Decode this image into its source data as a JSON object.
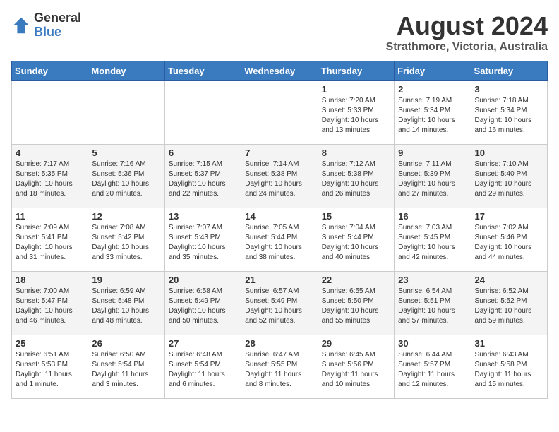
{
  "logo": {
    "line1": "General",
    "line2": "Blue"
  },
  "title": "August 2024",
  "subtitle": "Strathmore, Victoria, Australia",
  "days_header": [
    "Sunday",
    "Monday",
    "Tuesday",
    "Wednesday",
    "Thursday",
    "Friday",
    "Saturday"
  ],
  "weeks": [
    [
      {
        "num": "",
        "info": ""
      },
      {
        "num": "",
        "info": ""
      },
      {
        "num": "",
        "info": ""
      },
      {
        "num": "",
        "info": ""
      },
      {
        "num": "1",
        "info": "Sunrise: 7:20 AM\nSunset: 5:33 PM\nDaylight: 10 hours\nand 13 minutes."
      },
      {
        "num": "2",
        "info": "Sunrise: 7:19 AM\nSunset: 5:34 PM\nDaylight: 10 hours\nand 14 minutes."
      },
      {
        "num": "3",
        "info": "Sunrise: 7:18 AM\nSunset: 5:34 PM\nDaylight: 10 hours\nand 16 minutes."
      }
    ],
    [
      {
        "num": "4",
        "info": "Sunrise: 7:17 AM\nSunset: 5:35 PM\nDaylight: 10 hours\nand 18 minutes."
      },
      {
        "num": "5",
        "info": "Sunrise: 7:16 AM\nSunset: 5:36 PM\nDaylight: 10 hours\nand 20 minutes."
      },
      {
        "num": "6",
        "info": "Sunrise: 7:15 AM\nSunset: 5:37 PM\nDaylight: 10 hours\nand 22 minutes."
      },
      {
        "num": "7",
        "info": "Sunrise: 7:14 AM\nSunset: 5:38 PM\nDaylight: 10 hours\nand 24 minutes."
      },
      {
        "num": "8",
        "info": "Sunrise: 7:12 AM\nSunset: 5:38 PM\nDaylight: 10 hours\nand 26 minutes."
      },
      {
        "num": "9",
        "info": "Sunrise: 7:11 AM\nSunset: 5:39 PM\nDaylight: 10 hours\nand 27 minutes."
      },
      {
        "num": "10",
        "info": "Sunrise: 7:10 AM\nSunset: 5:40 PM\nDaylight: 10 hours\nand 29 minutes."
      }
    ],
    [
      {
        "num": "11",
        "info": "Sunrise: 7:09 AM\nSunset: 5:41 PM\nDaylight: 10 hours\nand 31 minutes."
      },
      {
        "num": "12",
        "info": "Sunrise: 7:08 AM\nSunset: 5:42 PM\nDaylight: 10 hours\nand 33 minutes."
      },
      {
        "num": "13",
        "info": "Sunrise: 7:07 AM\nSunset: 5:43 PM\nDaylight: 10 hours\nand 35 minutes."
      },
      {
        "num": "14",
        "info": "Sunrise: 7:05 AM\nSunset: 5:44 PM\nDaylight: 10 hours\nand 38 minutes."
      },
      {
        "num": "15",
        "info": "Sunrise: 7:04 AM\nSunset: 5:44 PM\nDaylight: 10 hours\nand 40 minutes."
      },
      {
        "num": "16",
        "info": "Sunrise: 7:03 AM\nSunset: 5:45 PM\nDaylight: 10 hours\nand 42 minutes."
      },
      {
        "num": "17",
        "info": "Sunrise: 7:02 AM\nSunset: 5:46 PM\nDaylight: 10 hours\nand 44 minutes."
      }
    ],
    [
      {
        "num": "18",
        "info": "Sunrise: 7:00 AM\nSunset: 5:47 PM\nDaylight: 10 hours\nand 46 minutes."
      },
      {
        "num": "19",
        "info": "Sunrise: 6:59 AM\nSunset: 5:48 PM\nDaylight: 10 hours\nand 48 minutes."
      },
      {
        "num": "20",
        "info": "Sunrise: 6:58 AM\nSunset: 5:49 PM\nDaylight: 10 hours\nand 50 minutes."
      },
      {
        "num": "21",
        "info": "Sunrise: 6:57 AM\nSunset: 5:49 PM\nDaylight: 10 hours\nand 52 minutes."
      },
      {
        "num": "22",
        "info": "Sunrise: 6:55 AM\nSunset: 5:50 PM\nDaylight: 10 hours\nand 55 minutes."
      },
      {
        "num": "23",
        "info": "Sunrise: 6:54 AM\nSunset: 5:51 PM\nDaylight: 10 hours\nand 57 minutes."
      },
      {
        "num": "24",
        "info": "Sunrise: 6:52 AM\nSunset: 5:52 PM\nDaylight: 10 hours\nand 59 minutes."
      }
    ],
    [
      {
        "num": "25",
        "info": "Sunrise: 6:51 AM\nSunset: 5:53 PM\nDaylight: 11 hours\nand 1 minute."
      },
      {
        "num": "26",
        "info": "Sunrise: 6:50 AM\nSunset: 5:54 PM\nDaylight: 11 hours\nand 3 minutes."
      },
      {
        "num": "27",
        "info": "Sunrise: 6:48 AM\nSunset: 5:54 PM\nDaylight: 11 hours\nand 6 minutes."
      },
      {
        "num": "28",
        "info": "Sunrise: 6:47 AM\nSunset: 5:55 PM\nDaylight: 11 hours\nand 8 minutes."
      },
      {
        "num": "29",
        "info": "Sunrise: 6:45 AM\nSunset: 5:56 PM\nDaylight: 11 hours\nand 10 minutes."
      },
      {
        "num": "30",
        "info": "Sunrise: 6:44 AM\nSunset: 5:57 PM\nDaylight: 11 hours\nand 12 minutes."
      },
      {
        "num": "31",
        "info": "Sunrise: 6:43 AM\nSunset: 5:58 PM\nDaylight: 11 hours\nand 15 minutes."
      }
    ]
  ]
}
